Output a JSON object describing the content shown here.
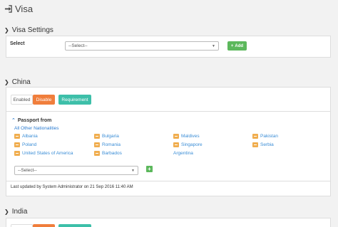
{
  "page": {
    "title": "Visa"
  },
  "visa_settings": {
    "heading": "Visa Settings",
    "select_label": "Select",
    "select_value": "--Select--",
    "add_label": "Add"
  },
  "china": {
    "heading": "China",
    "tabs": [
      "Enabled",
      "Disable",
      "Requirement"
    ],
    "passport_label": "Passport from",
    "all_other": "All Other Nationalities",
    "countries": [
      "Albania",
      "Bulgaria",
      "Maldives",
      "Pakistan",
      "Poland",
      "Romania",
      "Singapore",
      "Serbia",
      "United States of America",
      "Barbados",
      "Argentina"
    ],
    "select_value": "--Select--",
    "updated_text": "Last updated by System Administrator on 21 Sep 2016 11:40 AM"
  },
  "india": {
    "heading": "India"
  }
}
